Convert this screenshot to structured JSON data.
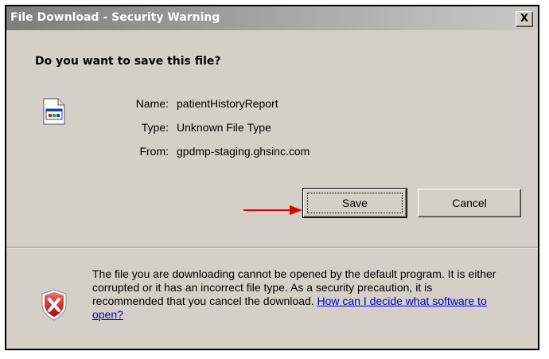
{
  "window": {
    "title": "File Download - Security Warning",
    "close_label": "X"
  },
  "prompt": {
    "question": "Do you want to save this file?"
  },
  "file_info": {
    "name_label": "Name:",
    "name_value": "patientHistoryReport",
    "type_label": "Type:",
    "type_value": "Unknown File Type",
    "from_label": "From:",
    "from_value": "gpdmp-staging.ghsinc.com",
    "icon": "generic-file-icon"
  },
  "buttons": {
    "save_label": "Save",
    "cancel_label": "Cancel"
  },
  "warning": {
    "icon": "security-shield-icon",
    "text": "The file you are downloading cannot be opened by the default program. It is either corrupted or it has an incorrect file type. As a security precaution, it is recommended that you cancel the download. ",
    "link_text": "How can I decide what software to open?"
  },
  "colors": {
    "dialog_bg": "#d4d0c8",
    "annotation_arrow": "#e00000",
    "link": "#0000cc"
  }
}
